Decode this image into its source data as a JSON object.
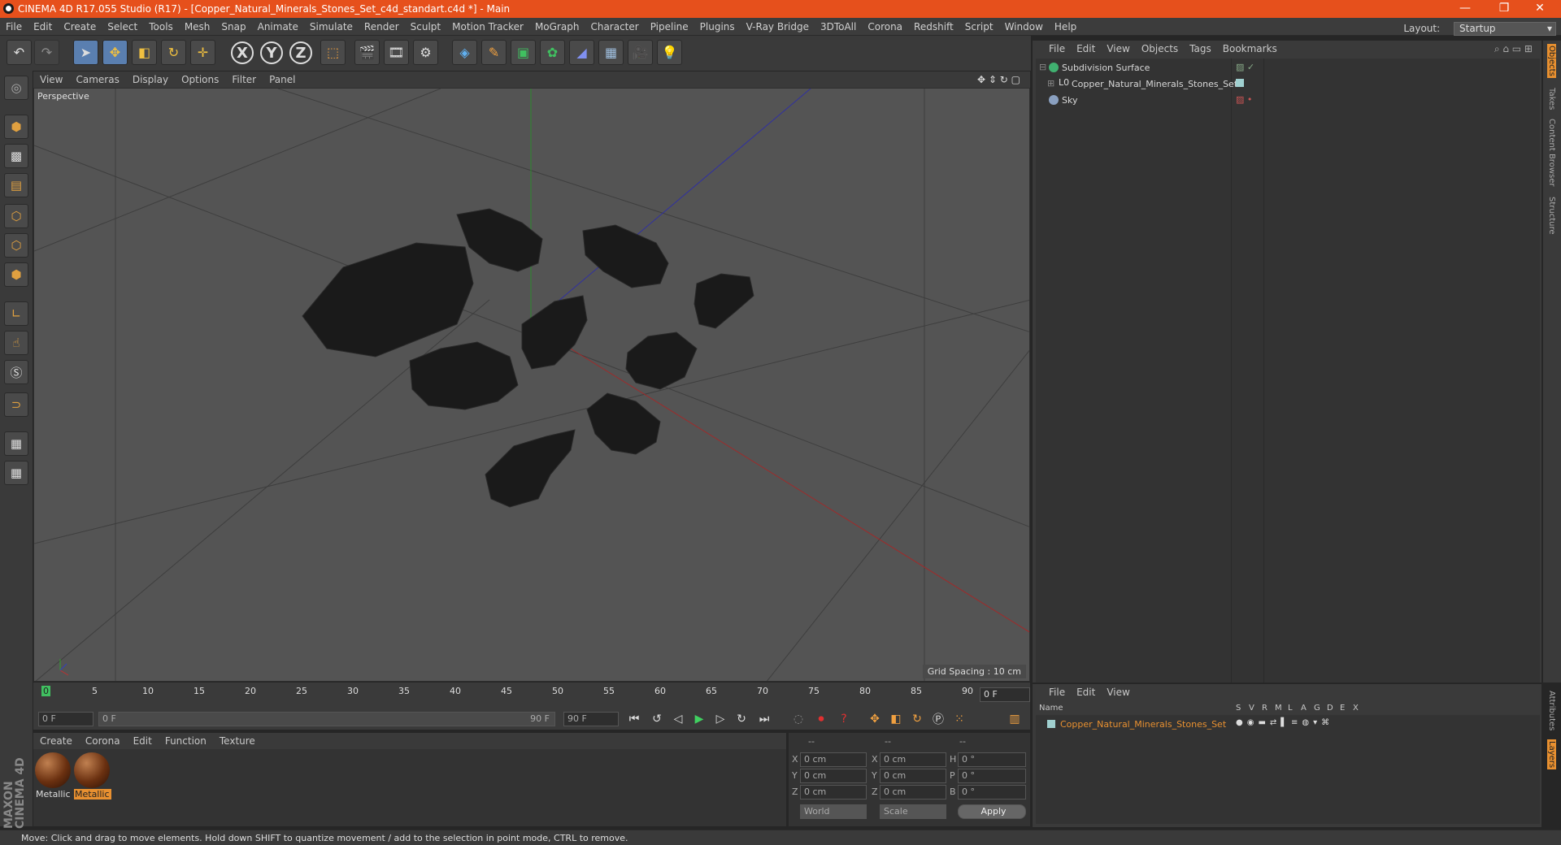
{
  "window": {
    "title": "CINEMA 4D R17.055 Studio (R17) - [Copper_Natural_Minerals_Stones_Set_c4d_standart.c4d *] - Main"
  },
  "menubar": {
    "items": [
      "File",
      "Edit",
      "Create",
      "Select",
      "Tools",
      "Mesh",
      "Snap",
      "Animate",
      "Simulate",
      "Render",
      "Sculpt",
      "Motion Tracker",
      "MoGraph",
      "Character",
      "Pipeline",
      "Plugins",
      "V-Ray Bridge",
      "3DToAll",
      "Corona",
      "Redshift",
      "Script",
      "Window",
      "Help"
    ],
    "layout_label": "Layout:",
    "layout_value": "Startup"
  },
  "toolbar": {
    "axis_x": "X",
    "axis_y": "Y",
    "axis_z": "Z"
  },
  "viewport": {
    "menu": [
      "View",
      "Cameras",
      "Display",
      "Options",
      "Filter",
      "Panel"
    ],
    "label": "Perspective",
    "grid_spacing": "Grid Spacing : 10 cm"
  },
  "timeline": {
    "ticks": [
      "0",
      "5",
      "10",
      "15",
      "20",
      "25",
      "30",
      "35",
      "40",
      "45",
      "50",
      "55",
      "60",
      "65",
      "70",
      "75",
      "80",
      "85",
      "90"
    ],
    "current_frame": "0 F",
    "start_field": "0 F",
    "range_start": "0 F",
    "range_end": "90 F",
    "end_field": "90 F"
  },
  "materials": {
    "menu": [
      "Create",
      "Corona",
      "Edit",
      "Function",
      "Texture"
    ],
    "items": [
      {
        "label": "Metallic"
      },
      {
        "label": "Metallic"
      }
    ]
  },
  "coords": {
    "headers": [
      "--",
      "--",
      "--"
    ],
    "rows": [
      {
        "a": "X",
        "av": "0 cm",
        "b": "X",
        "bv": "0 cm",
        "c": "H",
        "cv": "0 °"
      },
      {
        "a": "Y",
        "av": "0 cm",
        "b": "Y",
        "bv": "0 cm",
        "c": "P",
        "cv": "0 °"
      },
      {
        "a": "Z",
        "av": "0 cm",
        "b": "Z",
        "bv": "0 cm",
        "c": "B",
        "cv": "0 °"
      }
    ],
    "world": "World",
    "scale": "Scale",
    "apply": "Apply"
  },
  "objects": {
    "menu": [
      "File",
      "Edit",
      "View",
      "Objects",
      "Tags",
      "Bookmarks"
    ],
    "rows": [
      {
        "name": "Subdivision Surface"
      },
      {
        "name": "Copper_Natural_Minerals_Stones_Set"
      },
      {
        "name": "Sky"
      }
    ]
  },
  "layers": {
    "menu": [
      "File",
      "Edit",
      "View"
    ],
    "columns": [
      "Name",
      "S",
      "V",
      "R",
      "M",
      "L",
      "A",
      "G",
      "D",
      "E",
      "X"
    ],
    "row": "Copper_Natural_Minerals_Stones_Set"
  },
  "side_tabs": [
    "Objects",
    "Takes",
    "Content Browser",
    "Structure"
  ],
  "side_tabs_lower": [
    "Attributes",
    "Layers"
  ],
  "branding": "MAXON CINEMA 4D",
  "status": "Move: Click and drag to move elements. Hold down SHIFT to quantize movement / add to the selection in point mode, CTRL to remove.",
  "colors": {
    "title_bar": "#e6501c",
    "selection": "#e89030",
    "axis_x": "#c03030",
    "axis_y": "#30a030",
    "axis_z": "#3040c0"
  }
}
